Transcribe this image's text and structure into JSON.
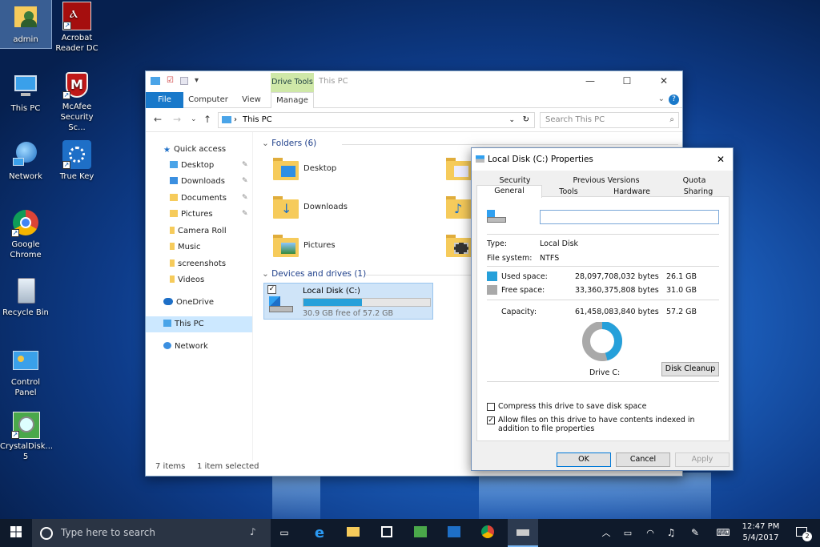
{
  "desktop": {
    "icons": [
      {
        "label": "admin"
      },
      {
        "label": "Acrobat Reader DC"
      },
      {
        "label": "This PC"
      },
      {
        "label": "McAfee Security Sc..."
      },
      {
        "label": "Network"
      },
      {
        "label": "True Key"
      },
      {
        "label": "Google Chrome"
      },
      {
        "label": "Recycle Bin"
      },
      {
        "label": "Control Panel"
      },
      {
        "label": "CrystalDisk... 5"
      }
    ]
  },
  "explorer": {
    "title": "This PC",
    "context_tab": "Drive Tools",
    "tabs": [
      "File",
      "Computer",
      "View",
      "Manage"
    ],
    "address": "This PC",
    "search_placeholder": "Search This PC",
    "nav": {
      "quick_access": "Quick access",
      "items": [
        "Desktop",
        "Downloads",
        "Documents",
        "Pictures",
        "Camera Roll",
        "Music",
        "screenshots",
        "Videos"
      ],
      "onedrive": "OneDrive",
      "this_pc": "This PC",
      "network": "Network"
    },
    "folders_header": "Folders (6)",
    "folders": [
      "Desktop",
      "Downloads",
      "Pictures"
    ],
    "devices_header": "Devices and drives (1)",
    "drive": {
      "name": "Local Disk (C:)",
      "free_text": "30.9 GB free of 57.2 GB",
      "used_fraction": 0.46
    },
    "status": {
      "items": "7 items",
      "selected": "1 item selected"
    }
  },
  "properties": {
    "title": "Local Disk (C:) Properties",
    "tabs_row1": [
      "Security",
      "Previous Versions",
      "Quota"
    ],
    "tabs_row2": [
      "General",
      "Tools",
      "Hardware",
      "Sharing"
    ],
    "name_value": "",
    "type_label": "Type:",
    "type_value": "Local Disk",
    "fs_label": "File system:",
    "fs_value": "NTFS",
    "used_label": "Used space:",
    "used_bytes": "28,097,708,032 bytes",
    "used_gb": "26.1 GB",
    "free_label": "Free space:",
    "free_bytes": "33,360,375,808 bytes",
    "free_gb": "31.0 GB",
    "cap_label": "Capacity:",
    "cap_bytes": "61,458,083,840 bytes",
    "cap_gb": "57.2 GB",
    "drive_label": "Drive C:",
    "cleanup_label": "Disk Cleanup",
    "compress_label": "Compress this drive to save disk space",
    "index_label": "Allow files on this drive to have contents indexed in addition to file properties",
    "ok": "OK",
    "cancel": "Cancel",
    "apply": "Apply",
    "used_color": "#26a0da",
    "free_color": "#a9a9a9",
    "used_fraction": 0.457
  },
  "taskbar": {
    "search_placeholder": "Type here to search",
    "time": "12:47 PM",
    "date": "5/4/2017",
    "notifications": "2"
  }
}
